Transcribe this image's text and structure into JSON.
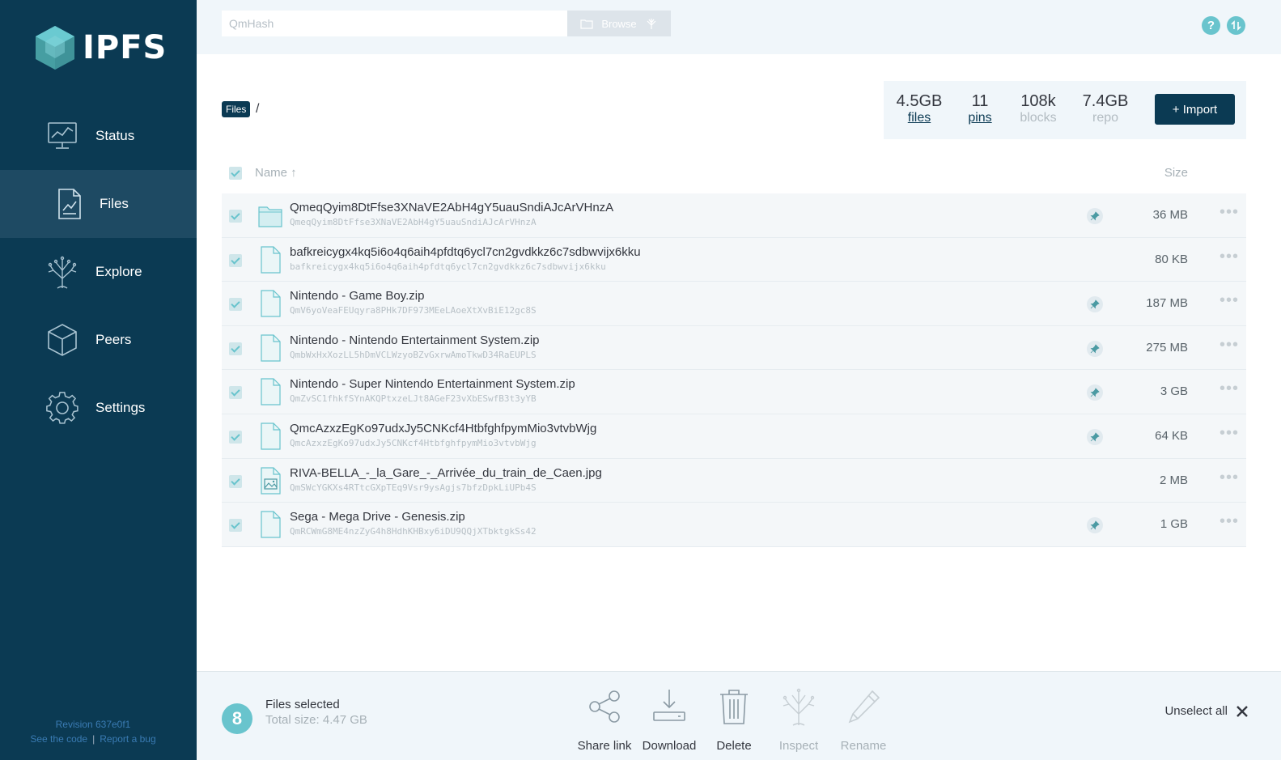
{
  "app": {
    "logo_text": "IPFS"
  },
  "sidebar": {
    "items": [
      {
        "label": "Status",
        "icon": "monitor-chart-icon"
      },
      {
        "label": "Files",
        "icon": "document-icon",
        "active": true
      },
      {
        "label": "Explore",
        "icon": "tree-icon"
      },
      {
        "label": "Peers",
        "icon": "cube-icon"
      },
      {
        "label": "Settings",
        "icon": "gear-icon"
      }
    ],
    "revision": "Revision 637e0f1",
    "see_code": "See the code",
    "report_bug": "Report a bug"
  },
  "topbar": {
    "search_placeholder": "QmHash",
    "browse_label": "Browse"
  },
  "breadcrumb": {
    "root": "Files",
    "separator": "/"
  },
  "stats": {
    "files": {
      "value": "4.5GB",
      "label": "files"
    },
    "pins": {
      "value": "11",
      "label": "pins"
    },
    "blocks": {
      "value": "108k",
      "label": "blocks"
    },
    "repo": {
      "value": "7.4GB",
      "label": "repo"
    }
  },
  "import_label": "+ Import",
  "table": {
    "col_name": "Name ↑",
    "col_size": "Size",
    "rows": [
      {
        "name": "QmeqQyim8DtFfse3XNaVE2AbH4gY5uauSndiAJcArVHnzA",
        "cid": "QmeqQyim8DtFfse3XNaVE2AbH4gY5uauSndiAJcArVHnzA",
        "size": "36 MB",
        "type": "folder",
        "pinned": true
      },
      {
        "name": "bafkreicygx4kq5i6o4q6aih4pfdtq6ycl7cn2gvdkkz6c7sdbwvijx6kku",
        "cid": "bafkreicygx4kq5i6o4q6aih4pfdtq6ycl7cn2gvdkkz6c7sdbwvijx6kku",
        "size": "80 KB",
        "type": "file",
        "pinned": false
      },
      {
        "name": "Nintendo - Game Boy.zip",
        "cid": "QmV6yoVeaFEUqyra8PHk7DF973MEeLAoeXtXvBiE12gc8S",
        "size": "187 MB",
        "type": "file",
        "pinned": true
      },
      {
        "name": "Nintendo - Nintendo Entertainment System.zip",
        "cid": "QmbWxHxXozLL5hDmVCLWzyoBZvGxrwAmoTkwD34RaEUPLS",
        "size": "275 MB",
        "type": "file",
        "pinned": true
      },
      {
        "name": "Nintendo - Super Nintendo Entertainment System.zip",
        "cid": "QmZvSC1fhkfSYnAKQPtxzeLJt8AGeF23vXbESwfB3t3yYB",
        "size": "3 GB",
        "type": "file",
        "pinned": true
      },
      {
        "name": "QmcAzxzEgKo97udxJy5CNKcf4HtbfghfpymMio3vtvbWjg",
        "cid": "QmcAzxzEgKo97udxJy5CNKcf4HtbfghfpymMio3vtvbWjg",
        "size": "64 KB",
        "type": "file",
        "pinned": true
      },
      {
        "name": "RIVA-BELLA_-_la_Gare_-_Arrivée_du_train_de_Caen.jpg",
        "cid": "QmSWcYGKXs4RTtcGXpTEq9Vsr9ysAgjs7bfzDpkLiUPb4S",
        "size": "2 MB",
        "type": "image",
        "pinned": false
      },
      {
        "name": "Sega - Mega Drive - Genesis.zip",
        "cid": "QmRCWmG8ME4nzZyG4h8HdhKHBxy6iDU9QQjXTbktgkSs42",
        "size": "1 GB",
        "type": "file",
        "pinned": true
      }
    ]
  },
  "selection": {
    "count": "8",
    "title": "Files selected",
    "total": "Total size: 4.47 GB",
    "actions": [
      {
        "label": "Share link",
        "icon": "share-icon",
        "enabled": true
      },
      {
        "label": "Download",
        "icon": "download-icon",
        "enabled": true
      },
      {
        "label": "Delete",
        "icon": "trash-icon",
        "enabled": true
      },
      {
        "label": "Inspect",
        "icon": "inspect-tree-icon",
        "enabled": false
      },
      {
        "label": "Rename",
        "icon": "pencil-icon",
        "enabled": false
      }
    ],
    "unselect_label": "Unselect all"
  },
  "colors": {
    "sidebar": "#0b3a53",
    "accent": "#69c4cd",
    "nav_active": "#1e4a63"
  }
}
